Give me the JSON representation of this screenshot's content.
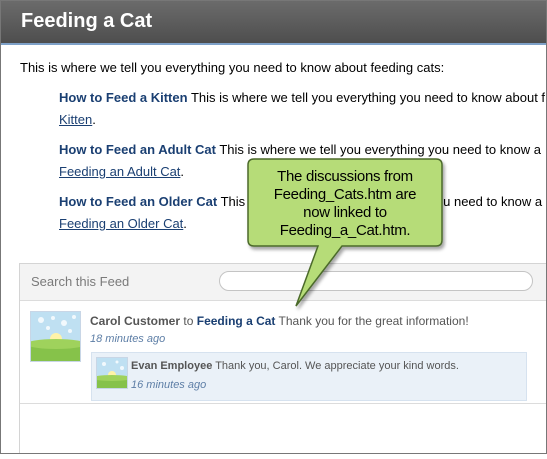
{
  "header": {
    "title": "Feeding a Cat"
  },
  "intro": "This is where we tell you everything you need to know about feeding cats:",
  "topics": [
    {
      "title": "How to Feed a Kitten",
      "text": "This is where we tell you everything you need to know about f",
      "link": "Kitten"
    },
    {
      "title": "How to Feed an Adult Cat",
      "text": "This is where we tell you everything you need to know a",
      "link": "Feeding an Adult Cat"
    },
    {
      "title": "How to Feed an Older Cat",
      "text": "This is where we tell you everything you need to know a",
      "link": "Feeding an Older Cat"
    }
  ],
  "callout": {
    "lines": [
      "The discussions from",
      "Feeding_Cats.htm are",
      "now linked to",
      "Feeding_a_Cat.htm."
    ],
    "fill": "#b6dc78",
    "stroke": "#4c6a2c"
  },
  "feed": {
    "search_label": "Search this Feed",
    "post": {
      "author": "Carol Customer",
      "connector": "to",
      "target": "Feeding a Cat",
      "message": "Thank you for the great information!",
      "time": "18 minutes ago"
    },
    "reply": {
      "author": "Evan Employee",
      "message": "Thank you, Carol. We appreciate your kind words.",
      "time": "16 minutes ago"
    }
  },
  "colors": {
    "header_bg": "#5b5b5b",
    "link": "#1a3f72",
    "timestamp": "#5d7ea6",
    "reply_bg": "#eaf1f8"
  }
}
